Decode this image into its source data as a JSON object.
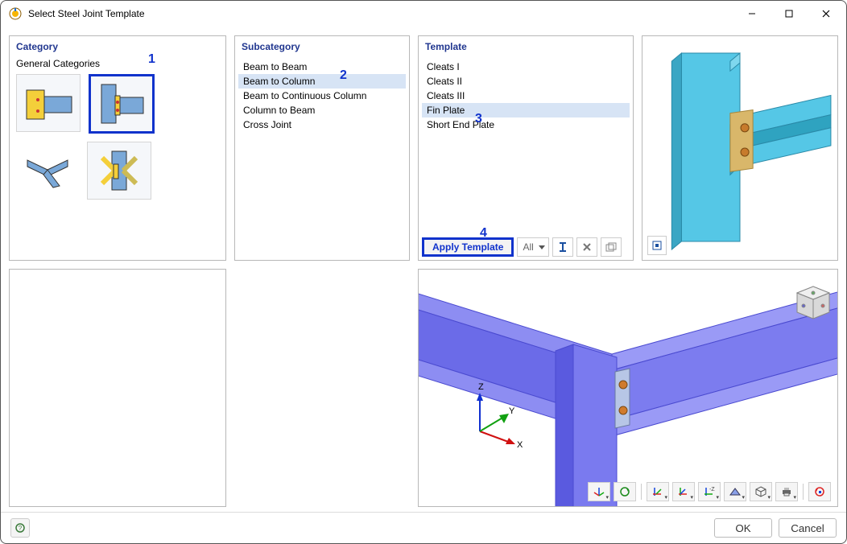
{
  "window": {
    "title": "Select Steel Joint Template"
  },
  "panels": {
    "category": "Category",
    "subcategory": "Subcategory",
    "template": "Template"
  },
  "category": {
    "general_label": "General Categories",
    "thumbs": [
      {
        "name": "beam-to-beam"
      },
      {
        "name": "beam-to-column",
        "selected": true
      },
      {
        "name": "cross-joint"
      },
      {
        "name": "column-to-beam"
      }
    ],
    "annot": "1"
  },
  "subcategory": {
    "items": [
      {
        "label": "Beam to Beam"
      },
      {
        "label": "Beam to Column",
        "selected": true
      },
      {
        "label": "Beam to Continuous Column"
      },
      {
        "label": "Column to Beam"
      },
      {
        "label": "Cross Joint"
      }
    ],
    "annot": "2"
  },
  "template": {
    "items": [
      {
        "label": "Cleats I"
      },
      {
        "label": "Cleats II"
      },
      {
        "label": "Cleats III"
      },
      {
        "label": "Fin Plate",
        "selected": true
      },
      {
        "label": "Short End Plate"
      }
    ],
    "annot_sel": "3",
    "annot_btn": "4",
    "apply_label": "Apply Template",
    "filter_label": "All"
  },
  "footer": {
    "ok": "OK",
    "cancel": "Cancel"
  },
  "axes": {
    "x": "X",
    "y": "Y",
    "z": "Z"
  }
}
